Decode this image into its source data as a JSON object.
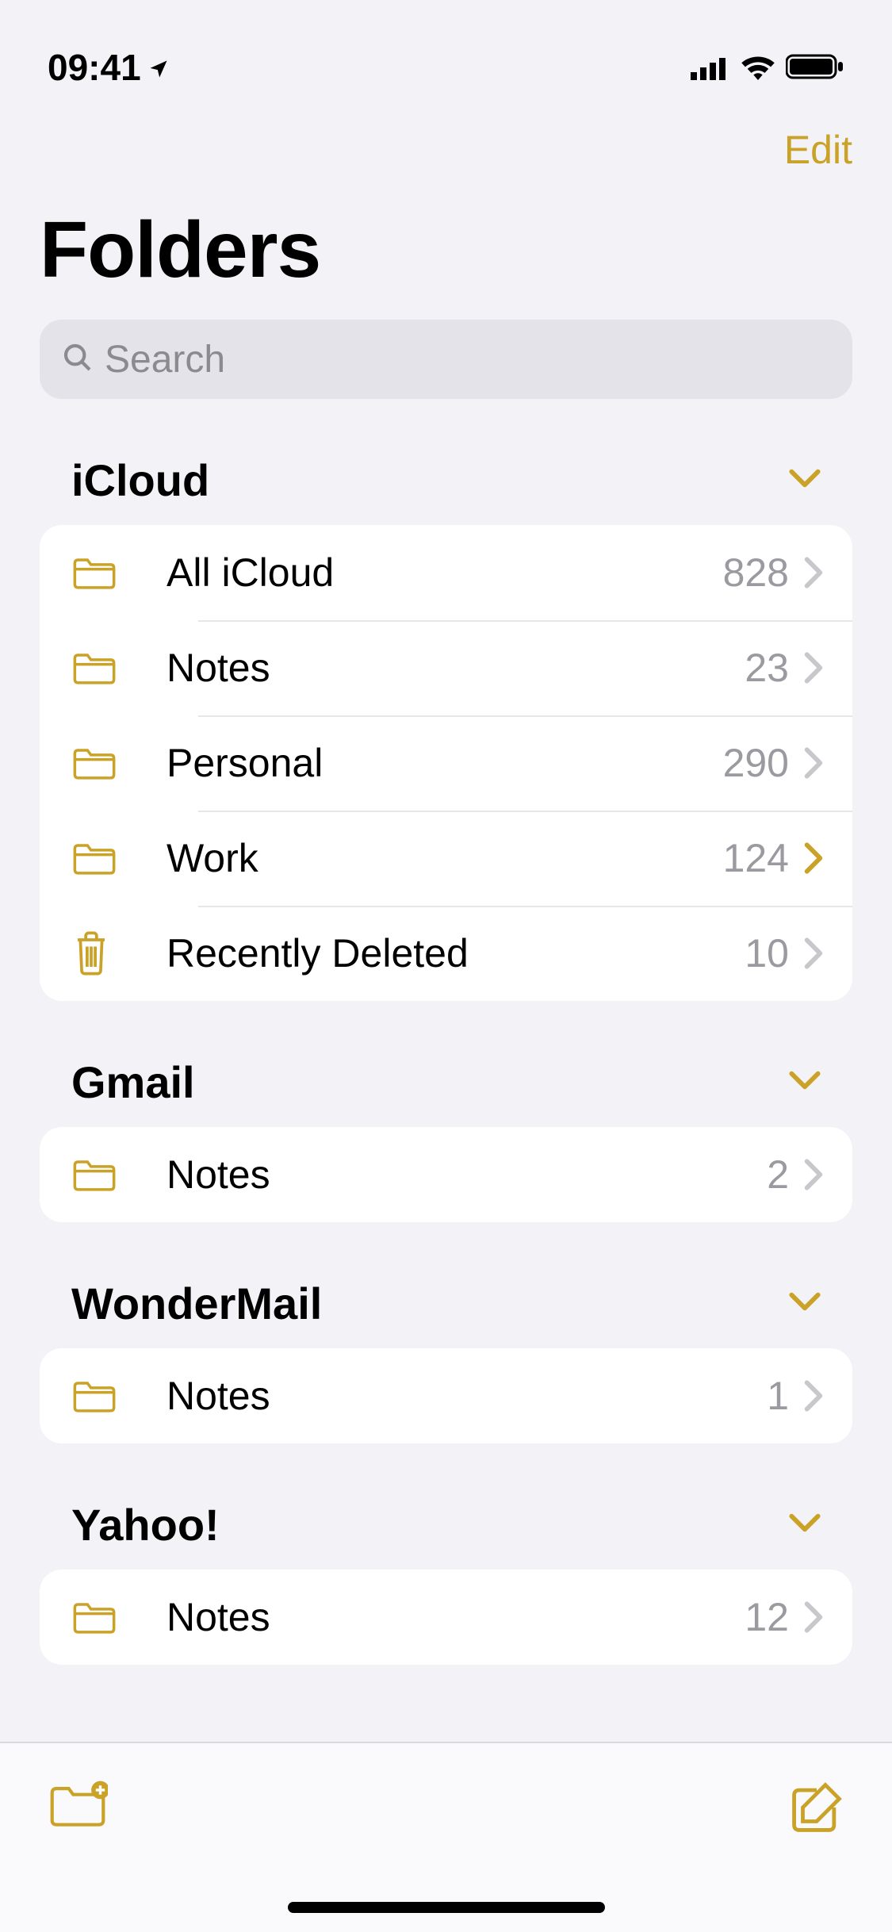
{
  "status": {
    "time": "09:41"
  },
  "nav": {
    "edit_label": "Edit"
  },
  "title": "Folders",
  "search": {
    "placeholder": "Search"
  },
  "accent": "#c9a227",
  "sections": [
    {
      "title": "iCloud",
      "rows": [
        {
          "icon": "folder",
          "label": "All iCloud",
          "count": "828",
          "active": false
        },
        {
          "icon": "folder",
          "label": "Notes",
          "count": "23",
          "active": false
        },
        {
          "icon": "folder",
          "label": "Personal",
          "count": "290",
          "active": false
        },
        {
          "icon": "folder",
          "label": "Work",
          "count": "124",
          "active": true
        },
        {
          "icon": "trash",
          "label": "Recently Deleted",
          "count": "10",
          "active": false
        }
      ]
    },
    {
      "title": "Gmail",
      "rows": [
        {
          "icon": "folder",
          "label": "Notes",
          "count": "2",
          "active": false
        }
      ]
    },
    {
      "title": "WonderMail",
      "rows": [
        {
          "icon": "folder",
          "label": "Notes",
          "count": "1",
          "active": false
        }
      ]
    },
    {
      "title": "Yahoo!",
      "rows": [
        {
          "icon": "folder",
          "label": "Notes",
          "count": "12",
          "active": false
        }
      ]
    }
  ]
}
